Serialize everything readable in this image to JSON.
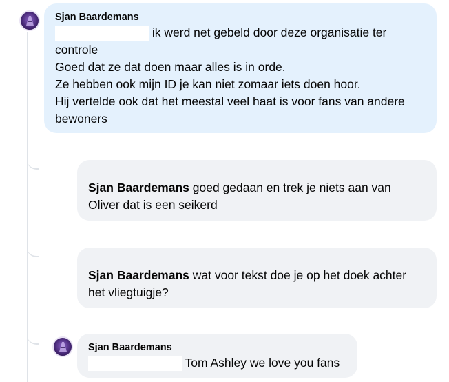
{
  "thread": {
    "comment": {
      "author": "Sjan Baardemans",
      "line1_text": "ik werd net gebeld door deze organisatie ter",
      "lines": [
        "controle",
        "Goed dat ze dat doen maar alles is in orde.",
        "Ze hebben ook mijn ID je kan niet zomaar iets doen hoor.",
        "Hij vertelde ook dat het meestal veel haat is voor fans van andere",
        "bewoners"
      ]
    },
    "replies": [
      {
        "author": "Sjan Baardemans",
        "text_line1": "goed gedaan en trek je niets aan van",
        "text_line2": "Oliver dat is een seikerd"
      },
      {
        "author": "Sjan Baardemans",
        "text_line1": "wat voor tekst doe je op het doek achter",
        "text_line2": "het vliegtuigje?"
      }
    ],
    "bottom_comment": {
      "author": "Sjan Baardemans",
      "text": "Tom Ashley we love you fans"
    }
  },
  "icons": {
    "avatar": "profile-avatar-icon"
  },
  "colors": {
    "main_bubble": "#e4f1fd",
    "reply_bubble": "#f0f2f5",
    "thread_line": "#dfe3e8"
  }
}
